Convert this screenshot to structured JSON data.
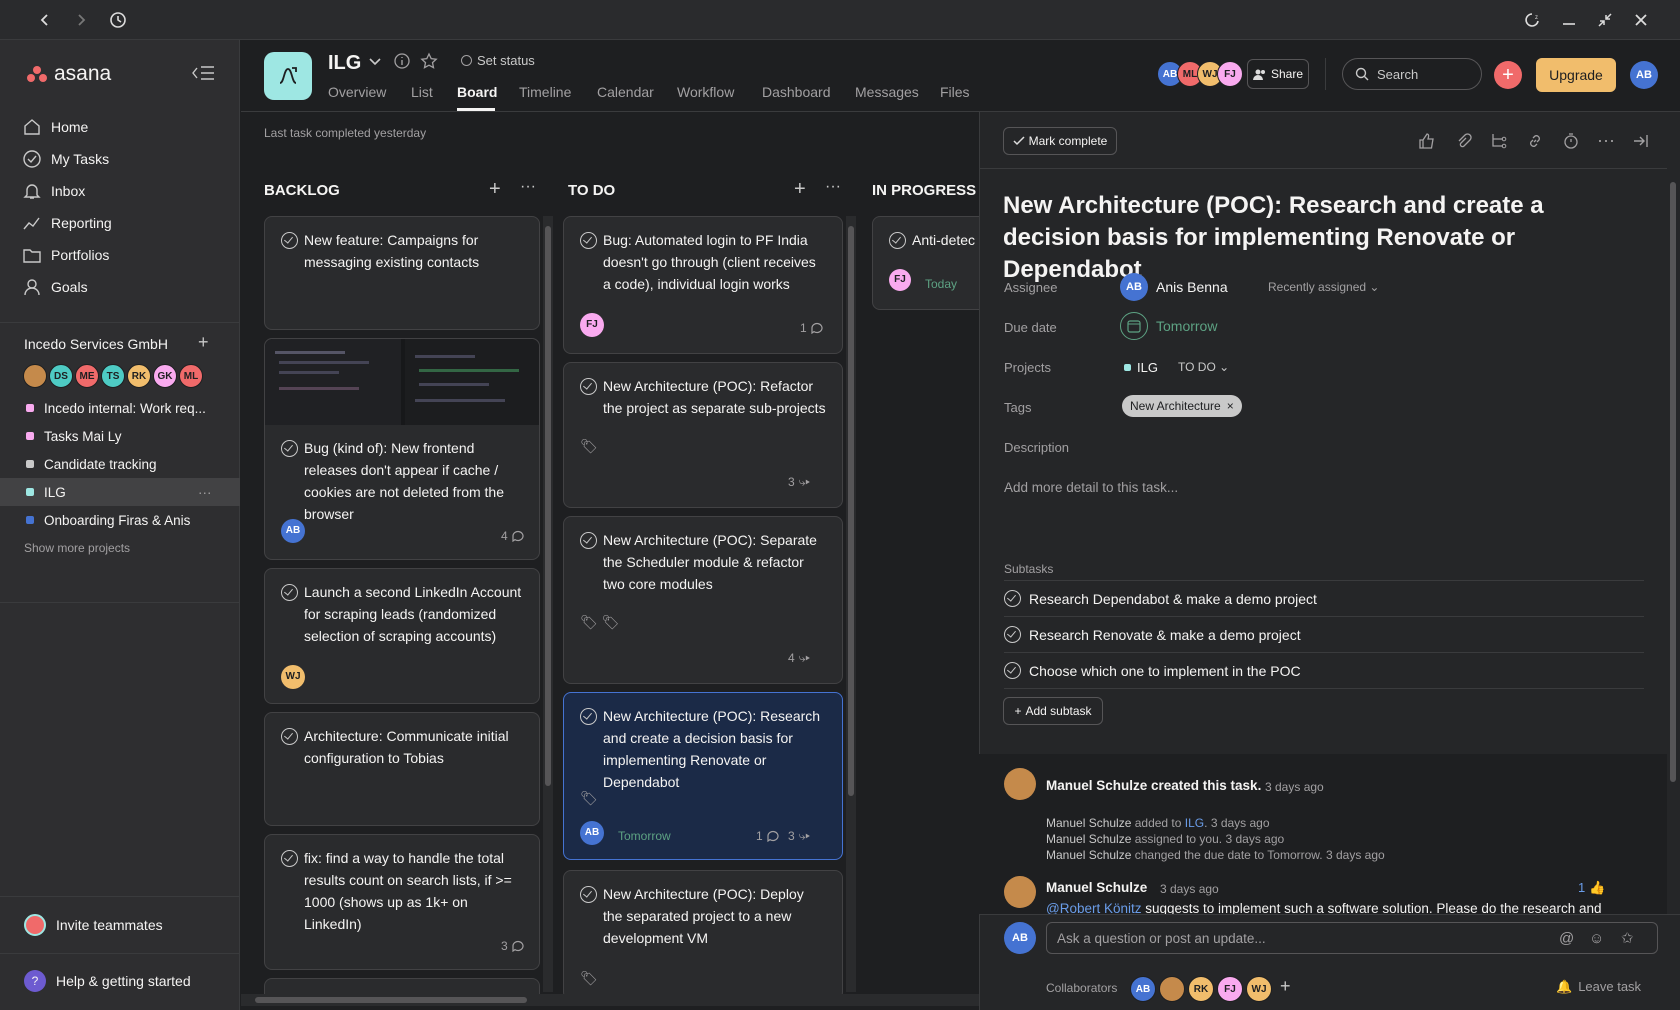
{
  "titlebar": {
    "back": "back-icon",
    "forward": "forward-icon",
    "history": "history-icon"
  },
  "sidebar": {
    "logo": "asana",
    "nav": [
      {
        "label": "Home",
        "icon": "home-icon"
      },
      {
        "label": "My Tasks",
        "icon": "check-circle-icon"
      },
      {
        "label": "Inbox",
        "icon": "bell-icon"
      },
      {
        "label": "Reporting",
        "icon": "chart-icon"
      },
      {
        "label": "Portfolios",
        "icon": "folder-icon"
      },
      {
        "label": "Goals",
        "icon": "person-icon"
      }
    ],
    "team": "Incedo Services GmbH",
    "members": [
      {
        "initials": "",
        "color": "#c58a4b"
      },
      {
        "initials": "DS",
        "color": "#4ecbc4"
      },
      {
        "initials": "ME",
        "color": "#f06a6a"
      },
      {
        "initials": "TS",
        "color": "#4ecbc4"
      },
      {
        "initials": "RK",
        "color": "#f1bd6c"
      },
      {
        "initials": "GK",
        "color": "#f9aaef"
      },
      {
        "initials": "ML",
        "color": "#f06a6a"
      }
    ],
    "projects": [
      {
        "label": "Incedo internal: Work req...",
        "color": "#f9aaef"
      },
      {
        "label": "Tasks Mai Ly",
        "color": "#f9aaef"
      },
      {
        "label": "Candidate tracking",
        "color": "#c9c9c9"
      },
      {
        "label": "ILG",
        "color": "#9ee7e3"
      },
      {
        "label": "Onboarding Firas & Anis",
        "color": "#4573d2"
      }
    ],
    "show_more": "Show more projects",
    "invite": "Invite teammates",
    "help": "Help & getting started"
  },
  "header": {
    "project": "ILG",
    "set_status": "Set status",
    "tabs": [
      "Overview",
      "List",
      "Board",
      "Timeline",
      "Calendar",
      "Workflow",
      "Dashboard",
      "Messages",
      "Files"
    ],
    "active_tab": "Board",
    "avatars": [
      {
        "initials": "AB",
        "color": "#4573d2"
      },
      {
        "initials": "ML",
        "color": "#f06a6a"
      },
      {
        "initials": "WJ",
        "color": "#f1bd6c"
      },
      {
        "initials": "FJ",
        "color": "#f9aaef"
      }
    ],
    "share": "Share",
    "search": "Search",
    "upgrade": "Upgrade",
    "me": "AB",
    "last_completed": "Last task completed yesterday"
  },
  "board": {
    "columns": [
      {
        "title": "BACKLOG",
        "cards": [
          {
            "title": "New feature: Campaigns for messaging existing contacts"
          },
          {
            "title": "Bug (kind of): New frontend releases don't appear if cache / cookies are not deleted from the browser",
            "assignee": "AB",
            "comments": "4"
          },
          {
            "title": "Launch a second LinkedIn Account for scraping leads (randomized selection of scraping accounts)",
            "assignee": "WJ"
          },
          {
            "title": "Architecture: Communicate initial configuration to Tobias"
          },
          {
            "title": "fix: find a way to handle the total results count on search lists, if >= 1000 (shows up as 1k+ on LinkedIn)",
            "comments": "3"
          }
        ]
      },
      {
        "title": "TO DO",
        "cards": [
          {
            "title": "Bug: Automated login to PF India doesn't go through (client receives a code), individual login works",
            "assignee": "FJ",
            "comments": "1"
          },
          {
            "title": "New Architecture (POC): Refactor the project as separate sub-projects",
            "subtasks": "3"
          },
          {
            "title": "New Architecture (POC): Separate the Scheduler module & refactor two core modules",
            "subtasks": "4"
          },
          {
            "title": "New Architecture (POC): Research and create a decision basis for implementing Renovate or Dependabot",
            "assignee": "AB",
            "due": "Tomorrow",
            "comments": "1",
            "subtasks": "3"
          },
          {
            "title": "New Architecture (POC): Deploy the separated project to a new development VM"
          }
        ]
      },
      {
        "title": "IN PROGRESS (",
        "cards": [
          {
            "title": "Anti-detec",
            "assignee": "FJ",
            "due": "Today"
          }
        ]
      }
    ]
  },
  "task": {
    "mark_complete": "Mark complete",
    "title": "New Architecture (POC): Research and create a decision basis for implementing Renovate or Dependabot",
    "assignee_label": "Assignee",
    "assignee": "Anis Benna",
    "assignee_initials": "AB",
    "recent": "Recently assigned",
    "due_label": "Due date",
    "due": "Tomorrow",
    "projects_label": "Projects",
    "project": "ILG",
    "section": "TO DO",
    "tags_label": "Tags",
    "tag": "New Architecture",
    "desc_label": "Description",
    "desc_placeholder": "Add more detail to this task...",
    "subtasks_label": "Subtasks",
    "subtasks": [
      "Research Dependabot & make a demo project",
      "Research Renovate & make a demo project",
      "Choose which one to implement in the POC"
    ],
    "add_subtask": "Add subtask",
    "activity": {
      "creator": "Manuel Schulze created this task.",
      "created_time": "3 days ago",
      "events": [
        {
          "who": "Manuel Schulze",
          "what": " added to ",
          "link": "ILG",
          "post": ".",
          "time": "3 days ago"
        },
        {
          "who": "Manuel Schulze",
          "what": " assigned to you.",
          "link": "",
          "post": "",
          "time": "3 days ago"
        },
        {
          "who": "Manuel Schulze",
          "what": " changed the due date to Tomorrow.",
          "link": "",
          "post": "",
          "time": "3 days ago"
        }
      ],
      "comment_author": "Manuel Schulze",
      "comment_time": "3 days ago",
      "likes": "1",
      "mention": "@Robert Könitz",
      "comment_text": " suggests to implement such a software solution. Please do the research and"
    },
    "comment_placeholder": "Ask a question or post an update...",
    "collaborators_label": "Collaborators",
    "collaborators": [
      {
        "initials": "AB",
        "color": "#4573d2"
      },
      {
        "initials": "",
        "color": "#c58a4b"
      },
      {
        "initials": "RK",
        "color": "#f1bd6c"
      },
      {
        "initials": "FJ",
        "color": "#f9aaef"
      },
      {
        "initials": "WJ",
        "color": "#f1bd6c"
      }
    ],
    "leave": "Leave task"
  }
}
